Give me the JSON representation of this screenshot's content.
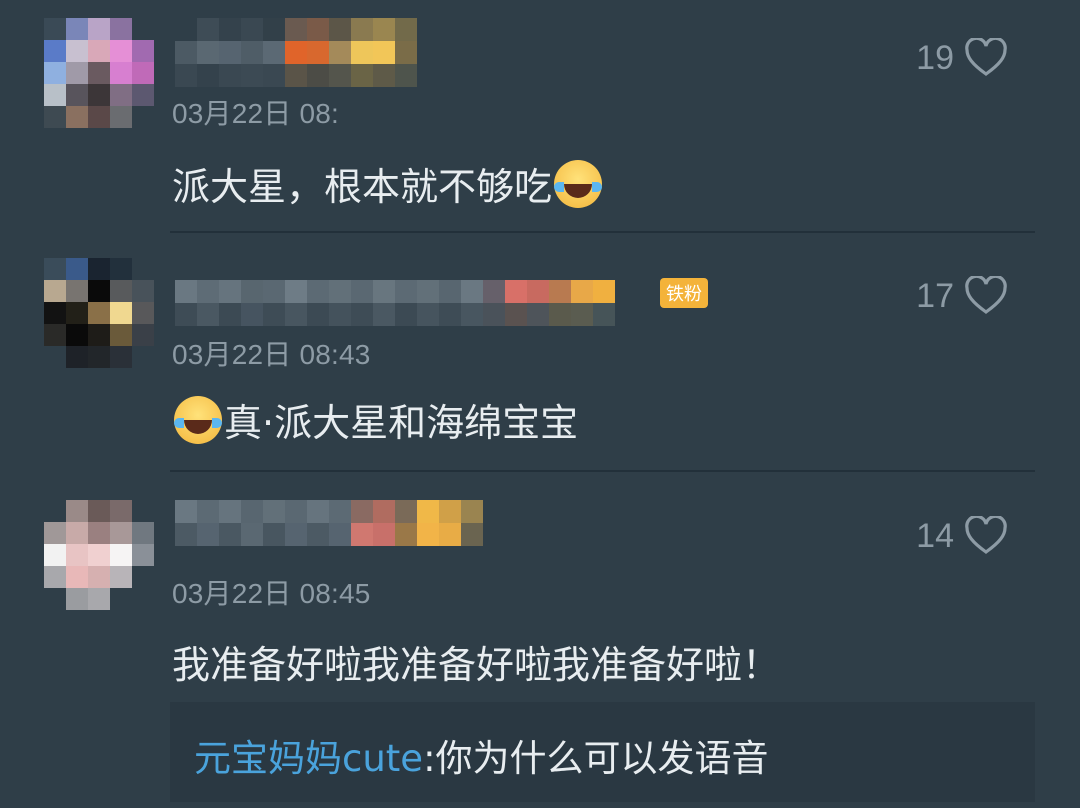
{
  "comments": [
    {
      "time": "03月22日 08:",
      "text": "派大星，根本就不够吃",
      "emoji": "laughing-tears",
      "likes": "19"
    },
    {
      "time": "03月22日 08:43",
      "text": "真·派大星和海绵宝宝",
      "emoji": "laughing-tears",
      "badge": "铁粉",
      "likes": "17"
    },
    {
      "time": "03月22日 08:45",
      "text": "我准备好啦我准备好啦我准备好啦！",
      "likes": "14",
      "reply": {
        "name": "元宝妈妈cute",
        "text": ":你为什么可以发语音"
      }
    }
  ],
  "colors": {
    "background": "#2f3e48",
    "meta_text": "#8d9ba5",
    "reply_name": "#4aa3dc"
  }
}
